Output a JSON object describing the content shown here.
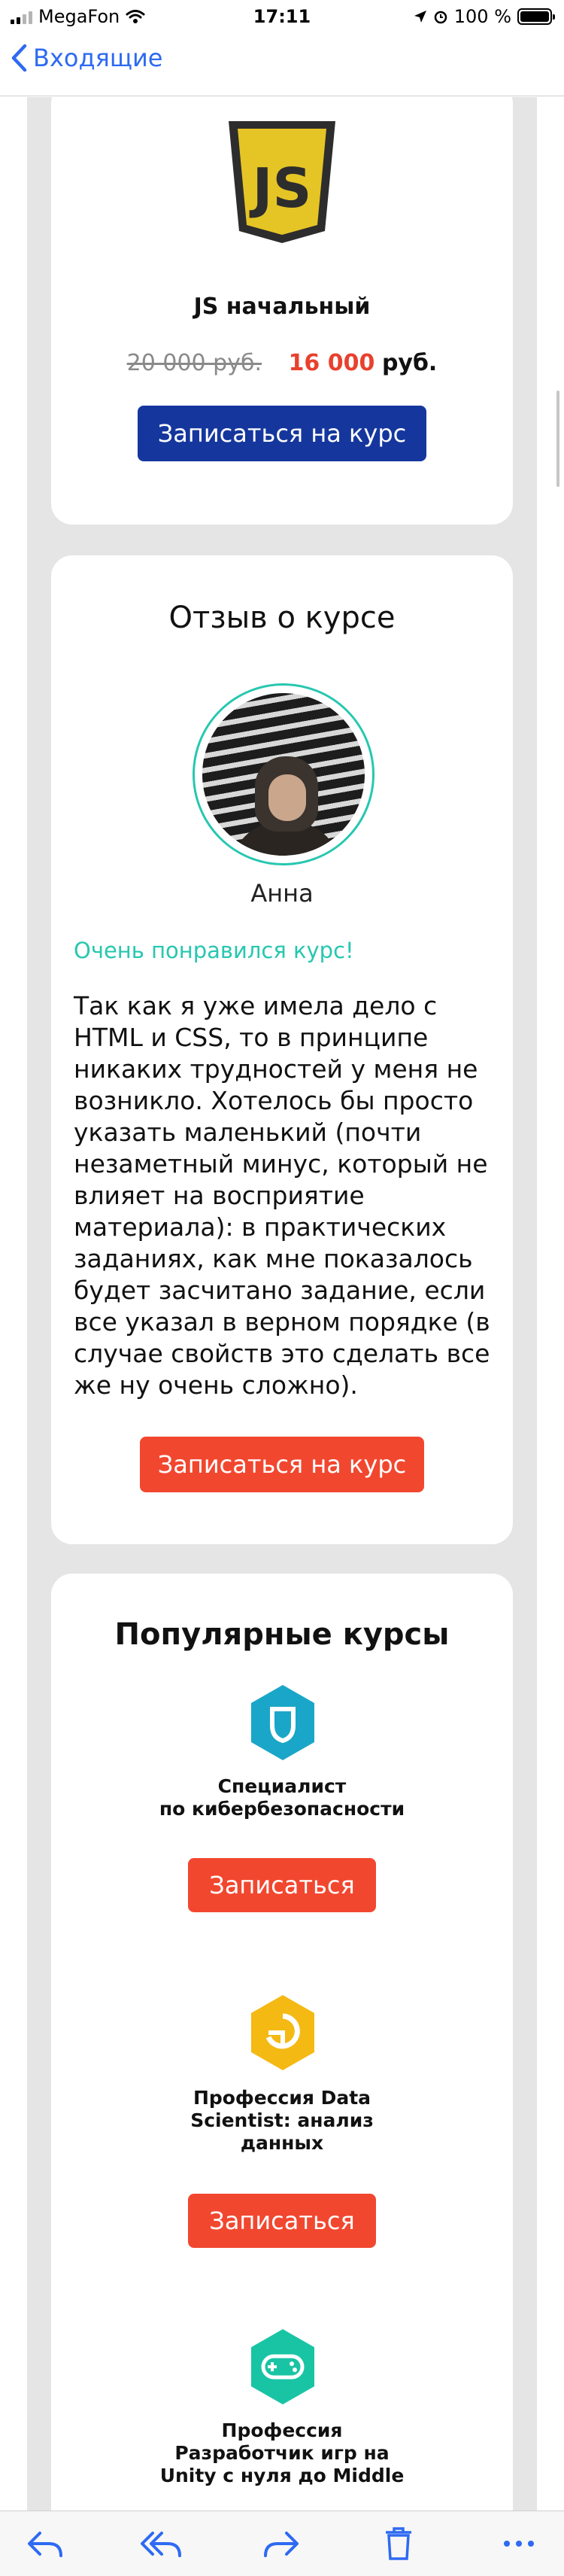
{
  "status_bar": {
    "carrier": "MegaFon",
    "time": "17:11",
    "battery": "100 %"
  },
  "nav": {
    "back_label": "Входящие"
  },
  "course_card": {
    "title": "JS начальный",
    "old_price": "20 000 руб.",
    "new_price": "16 000",
    "currency": "руб.",
    "button": "Записаться на курс",
    "logo_text": "JS"
  },
  "review_card": {
    "heading": "Отзыв о курсе",
    "reviewer_name": "Анна",
    "review_title": "Очень понравился курс!",
    "review_text": "Так как я уже имела дело с HTML и CSS, то в принципе никаких трудностей у меня не возникло. Хотелось бы просто указать маленький (почти незаметный минус, который не влияет на восприятие материала): в практических заданиях, как мне показалось будет засчитано задание, если все указал в верном порядке (в случае свойств это сделать все же ну очень сложно).",
    "button": "Записаться на курс"
  },
  "popular": {
    "heading": "Популярные курсы",
    "courses": [
      {
        "line1": "Специалист",
        "line2": "по кибербезопасности",
        "line3": "",
        "button": "Записаться",
        "icon": "shield-icon",
        "color": "#1aa6c8"
      },
      {
        "line1": "Профессия Data",
        "line2": "Scientist: анализ",
        "line3": "данных",
        "button": "Записаться",
        "icon": "data-science-icon",
        "color": "#f5b914"
      },
      {
        "line1": "Профессия",
        "line2": "Разработчик игр на",
        "line3": "Unity с нуля до Middle",
        "button": "Записаться",
        "icon": "gamepad-icon",
        "color": "#19c4a5"
      }
    ]
  },
  "colors": {
    "accent_blue": "#2e6af2",
    "brand_blue": "#15379d",
    "cta_red": "#f2472f",
    "teal": "#27c7b0"
  }
}
